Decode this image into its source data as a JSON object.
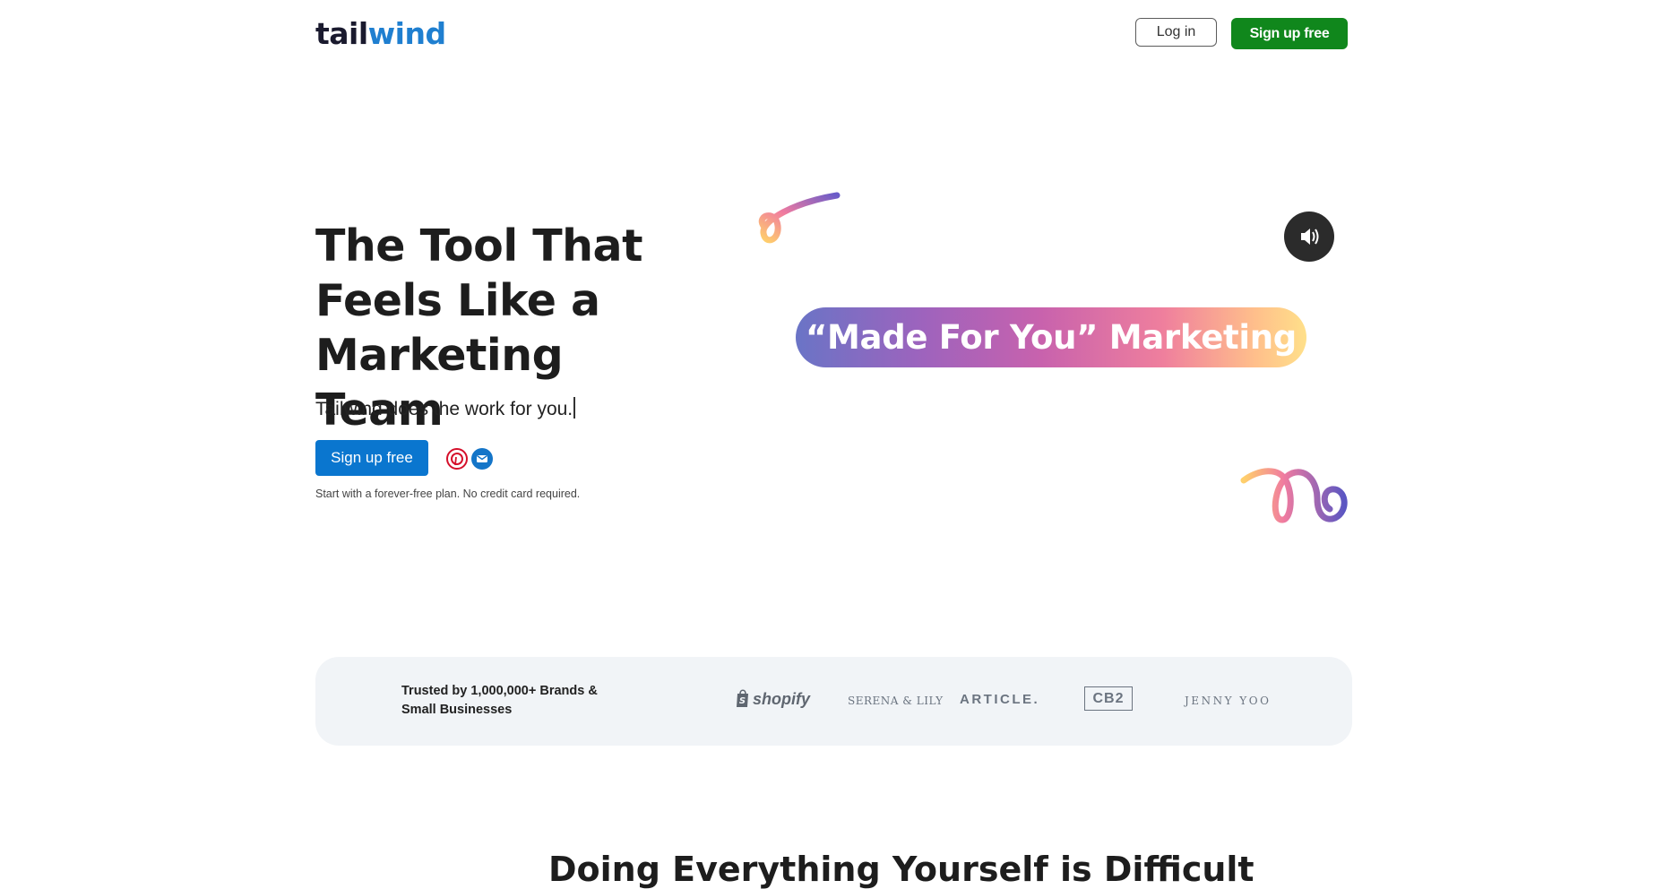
{
  "header": {
    "logo_text_1": "tail",
    "logo_text_2": "wind",
    "login_label": "Log in",
    "signup_label": "Sign up free"
  },
  "hero": {
    "title": "The Tool That Feels Like a Marketing Team",
    "subtitle": "Tailwind does the work for you.",
    "cta_label": "Sign up free",
    "note": "Start with a forever-free plan. No credit card required.",
    "social_icons": [
      "pinterest-icon",
      "email-icon"
    ]
  },
  "video": {
    "pill_text": "“Made For You” Marketing",
    "sound_icon": "speaker-icon"
  },
  "trust": {
    "text": "Trusted by 1,000,000+ Brands & Small Businesses",
    "brands": [
      "shopify",
      "SERENA & LILY",
      "ARTICLE.",
      "CB2",
      "JENNY YOO"
    ]
  },
  "bottom": {
    "heading": "Doing Everything Yourself is Difficult"
  },
  "colors": {
    "brand_green": "#10871c",
    "brand_blue": "#0a76cf",
    "pinterest_red": "#d5102b",
    "trust_bg": "#f1f4f7"
  }
}
